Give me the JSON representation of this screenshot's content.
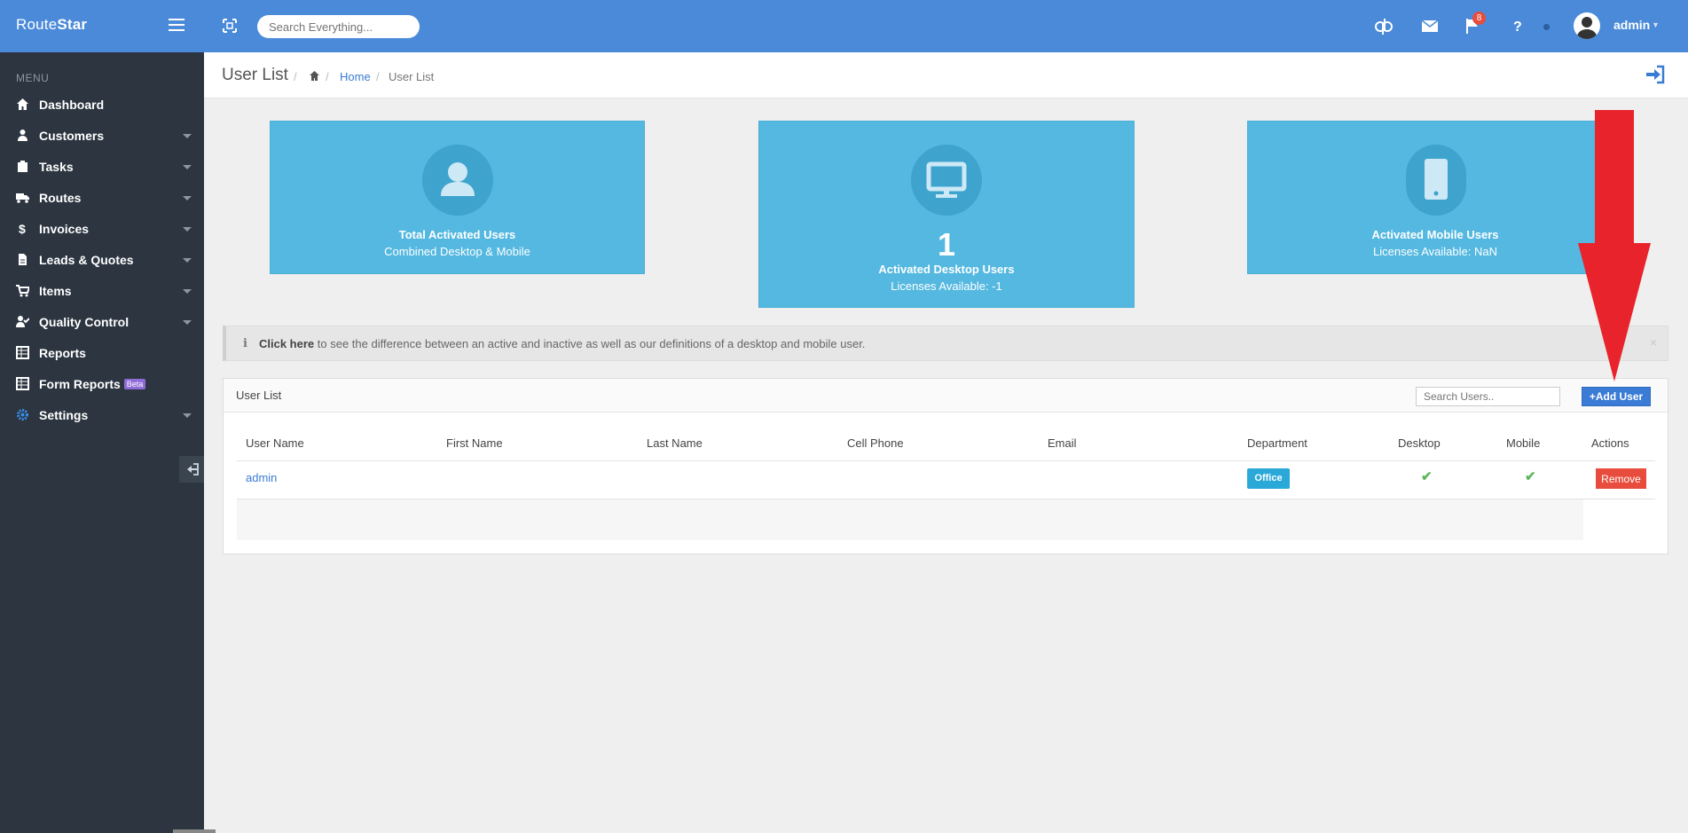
{
  "header": {
    "brand_light": "Route",
    "brand_bold": "Star",
    "search_placeholder": "Search Everything...",
    "notification_count": "8",
    "user_name": "admin",
    "accent_color": "#4a8ad9"
  },
  "sidebar": {
    "heading": "MENU",
    "items": [
      {
        "label": "Dashboard",
        "icon": "home-icon",
        "has_caret": false
      },
      {
        "label": "Customers",
        "icon": "user-icon",
        "has_caret": true
      },
      {
        "label": "Tasks",
        "icon": "clipboard-icon",
        "has_caret": true
      },
      {
        "label": "Routes",
        "icon": "truck-icon",
        "has_caret": true
      },
      {
        "label": "Invoices",
        "icon": "dollar-icon",
        "has_caret": true
      },
      {
        "label": "Leads & Quotes",
        "icon": "document-icon",
        "has_caret": true
      },
      {
        "label": "Items",
        "icon": "cart-icon",
        "has_caret": true
      },
      {
        "label": "Quality Control",
        "icon": "user-check-icon",
        "has_caret": true
      },
      {
        "label": "Reports",
        "icon": "table-icon",
        "has_caret": false
      },
      {
        "label": "Form Reports",
        "icon": "table-icon",
        "has_caret": false,
        "badge": "Beta"
      },
      {
        "label": "Settings",
        "icon": "gear-icon",
        "has_caret": true
      }
    ]
  },
  "page": {
    "title": "User List",
    "breadcrumb_home": "Home",
    "breadcrumb_current": "User List"
  },
  "cards": [
    {
      "big": "",
      "title": "Total Activated Users",
      "sub": "Combined Desktop & Mobile",
      "icon": "user-icon"
    },
    {
      "big": "1",
      "title": "Activated Desktop Users",
      "sub": "Licenses Available: -1",
      "icon": "monitor-icon"
    },
    {
      "big": "",
      "title": "Activated Mobile Users",
      "sub": "Licenses Available: NaN",
      "icon": "mobile-icon"
    }
  ],
  "alert": {
    "link_text": "Click here",
    "text": " to see the difference between an active and inactive as well as our definitions of a desktop and mobile user.",
    "close": "×"
  },
  "user_list": {
    "title": "User List",
    "search_placeholder": "Search Users..",
    "add_button": "Add User",
    "columns": [
      "User Name",
      "First Name",
      "Last Name",
      "Cell Phone",
      "Email",
      "Department",
      "Desktop",
      "Mobile",
      "Actions"
    ],
    "rows": [
      {
        "user_name": "admin",
        "first_name": "",
        "last_name": "",
        "cell_phone": "",
        "email": "",
        "department": "Office",
        "desktop": "✔",
        "mobile": "✔",
        "action": "Remove"
      }
    ]
  }
}
